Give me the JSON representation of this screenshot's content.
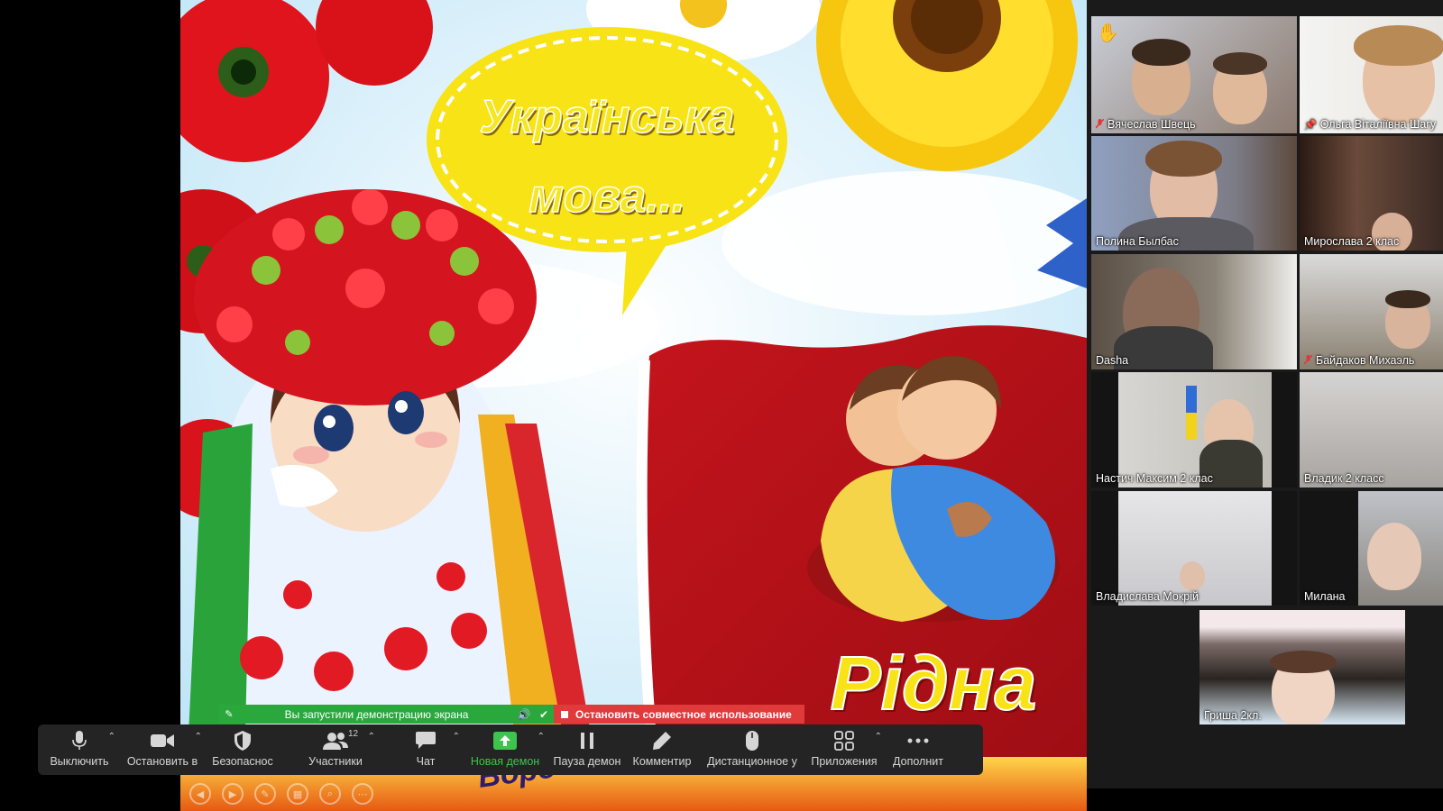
{
  "slide": {
    "title_line1": "Українська",
    "title_line2": "мова...",
    "bottom_word": "Рідна",
    "bottom_partial": "Воро"
  },
  "gallery": {
    "participants": [
      {
        "name": "Вячеслав Швець",
        "muted": true,
        "hand": true
      },
      {
        "name": "Ольга Віталіївна Шагу",
        "muted": false,
        "pinned": true,
        "active": true
      },
      {
        "name": "Полина Былбас",
        "muted": false
      },
      {
        "name": "Мирослава 2 клас",
        "muted": false
      },
      {
        "name": "Dasha",
        "muted": false
      },
      {
        "name": "Байдаков Михаэль",
        "muted": true
      },
      {
        "name": "Настич Максим 2 клас",
        "muted": false
      },
      {
        "name": "Владик 2 класс",
        "muted": false
      },
      {
        "name": "Владислава Мокрій",
        "muted": false
      },
      {
        "name": "Милана",
        "muted": false
      },
      {
        "name": "Гриша 2кл.",
        "muted": false
      }
    ]
  },
  "share_banner": {
    "status": "Вы запустили демонстрацию экрана",
    "stop": "Остановить совместное использование"
  },
  "toolbar": {
    "mute": "Выключить",
    "video": "Остановить в",
    "security": "Безопаснос",
    "participants": "Участники",
    "participants_count": "12",
    "chat": "Чат",
    "new_share": "Новая демон",
    "pause_share": "Пауза демон",
    "annotate": "Комментир",
    "remote_control": "Дистанционное у",
    "apps": "Приложения",
    "more": "Дополнит"
  },
  "colors": {
    "toolbar_bg": "#242424",
    "share_green": "#2aa83c",
    "stop_red": "#e03a3a",
    "accent_green": "#3ec34f",
    "title_yellow": "#f6e61e"
  }
}
